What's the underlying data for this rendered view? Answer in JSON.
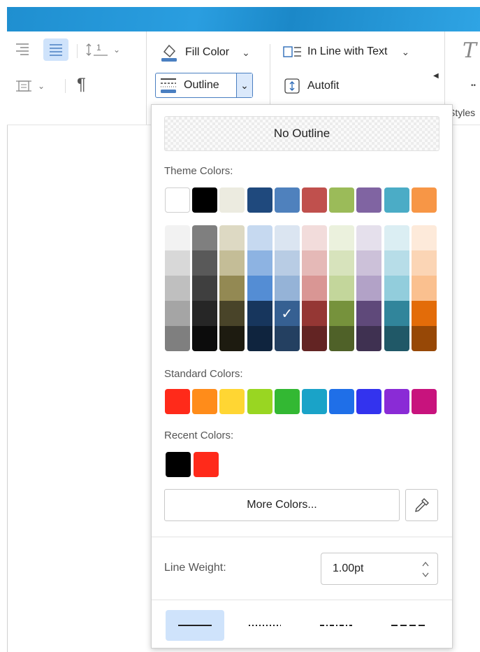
{
  "ribbon": {
    "fill_color_label": "Fill Color",
    "outline_label": "Outline",
    "wrap_label": "In Line with Text",
    "autofit_label": "Autofit",
    "styles_label": "Styles",
    "spacing_value": "1"
  },
  "outline_menu": {
    "no_outline_label": "No Outline",
    "theme_colors_label": "Theme Colors:",
    "standard_colors_label": "Standard Colors:",
    "recent_colors_label": "Recent Colors:",
    "more_colors_label": "More Colors...",
    "line_weight_label": "Line Weight:",
    "line_weight_value": "1.00pt",
    "line_styles": [
      "solid",
      "dotted",
      "dash-dot",
      "dashed"
    ],
    "selected_line_style": "solid",
    "theme_colors": [
      "#ffffff",
      "#000000",
      "#ecebe0",
      "#1f497d",
      "#4f81bd",
      "#c0504d",
      "#9bbb59",
      "#8064a2",
      "#4bacc6",
      "#f79646"
    ],
    "theme_shades": [
      [
        "#f2f2f2",
        "#d8d8d8",
        "#bfbfbf",
        "#a5a5a5",
        "#7f7f7f"
      ],
      [
        "#7f7f7f",
        "#595959",
        "#3f3f3f",
        "#262626",
        "#0c0c0c"
      ],
      [
        "#ddd9c3",
        "#c4bd97",
        "#938953",
        "#494429",
        "#1d1b10"
      ],
      [
        "#c6d9f0",
        "#8db3e2",
        "#548dd4",
        "#17365d",
        "#0f243e"
      ],
      [
        "#dbe5f1",
        "#b8cce4",
        "#95b3d7",
        "#366092",
        "#244061"
      ],
      [
        "#f2dcdb",
        "#e5b9b7",
        "#d99694",
        "#953734",
        "#632423"
      ],
      [
        "#ebf1dd",
        "#d7e3bc",
        "#c3d69b",
        "#76923c",
        "#4f6128"
      ],
      [
        "#e5e0ec",
        "#ccc1d9",
        "#b2a2c7",
        "#5f497a",
        "#3f3151"
      ],
      [
        "#dbeef3",
        "#b7dde8",
        "#92cddc",
        "#31859b",
        "#205867"
      ],
      [
        "#fdeada",
        "#fbd5b5",
        "#fac08f",
        "#e36c09",
        "#974806"
      ]
    ],
    "selected_shade": {
      "col": 4,
      "row": 3
    },
    "standard_colors": [
      "#ff2a1a",
      "#ff8c1a",
      "#ffd633",
      "#99d622",
      "#33b833",
      "#1aa3c8",
      "#1f6fe8",
      "#3333ee",
      "#8a2bd6",
      "#c8137d"
    ],
    "recent_colors": [
      "#000000",
      "#ff2a1a"
    ]
  }
}
